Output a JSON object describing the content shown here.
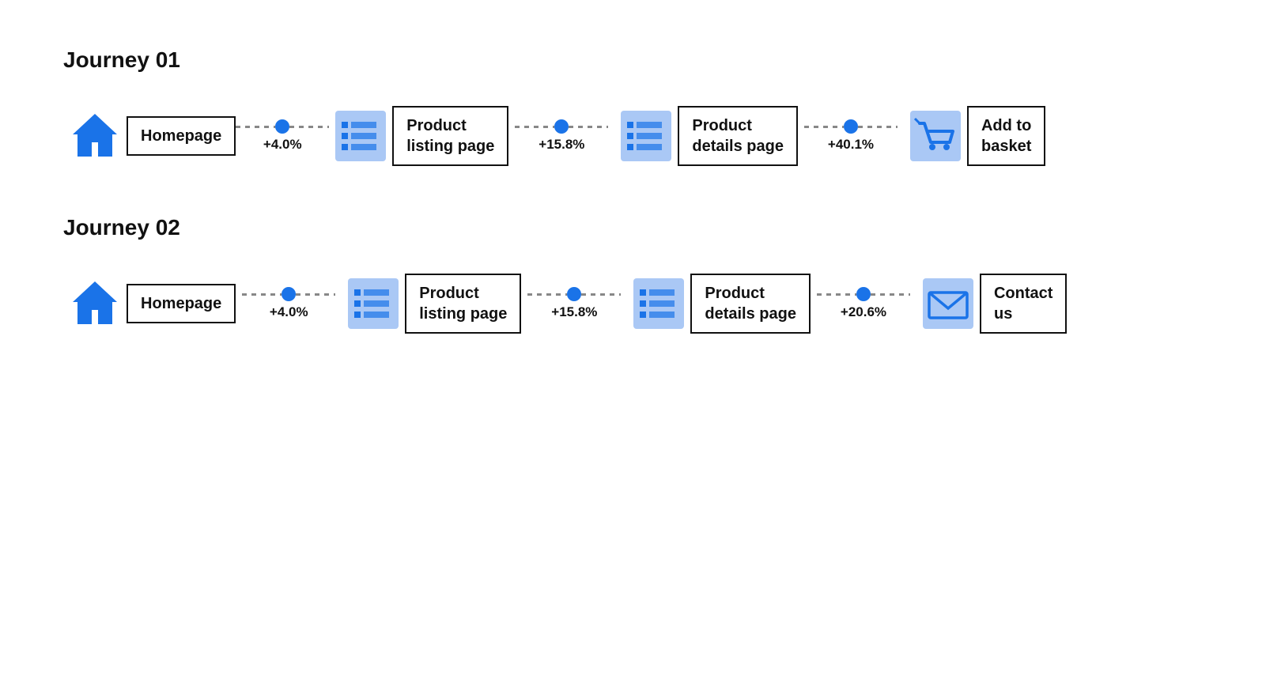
{
  "journeys": [
    {
      "id": "journey-01",
      "title": "Journey 01",
      "steps": [
        {
          "icon": "home",
          "label": "Homepage",
          "multiline": false
        },
        {
          "connector_pct": "+4.0%"
        },
        {
          "icon": "list",
          "label": "Product listing page",
          "multiline": true
        },
        {
          "connector_pct": "+15.8%"
        },
        {
          "icon": "list",
          "label": "Product details page",
          "multiline": true
        },
        {
          "connector_pct": "+40.1%"
        },
        {
          "icon": "cart",
          "label": "Add to basket",
          "multiline": true
        }
      ]
    },
    {
      "id": "journey-02",
      "title": "Journey 02",
      "steps": [
        {
          "icon": "home",
          "label": "Homepage",
          "multiline": false
        },
        {
          "connector_pct": "+4.0%"
        },
        {
          "icon": "list",
          "label": "Product listing page",
          "multiline": true
        },
        {
          "connector_pct": "+15.8%"
        },
        {
          "icon": "list",
          "label": "Product details page",
          "multiline": true
        },
        {
          "connector_pct": "+20.6%"
        },
        {
          "icon": "mail",
          "label": "Contact us",
          "multiline": true
        }
      ]
    }
  ]
}
